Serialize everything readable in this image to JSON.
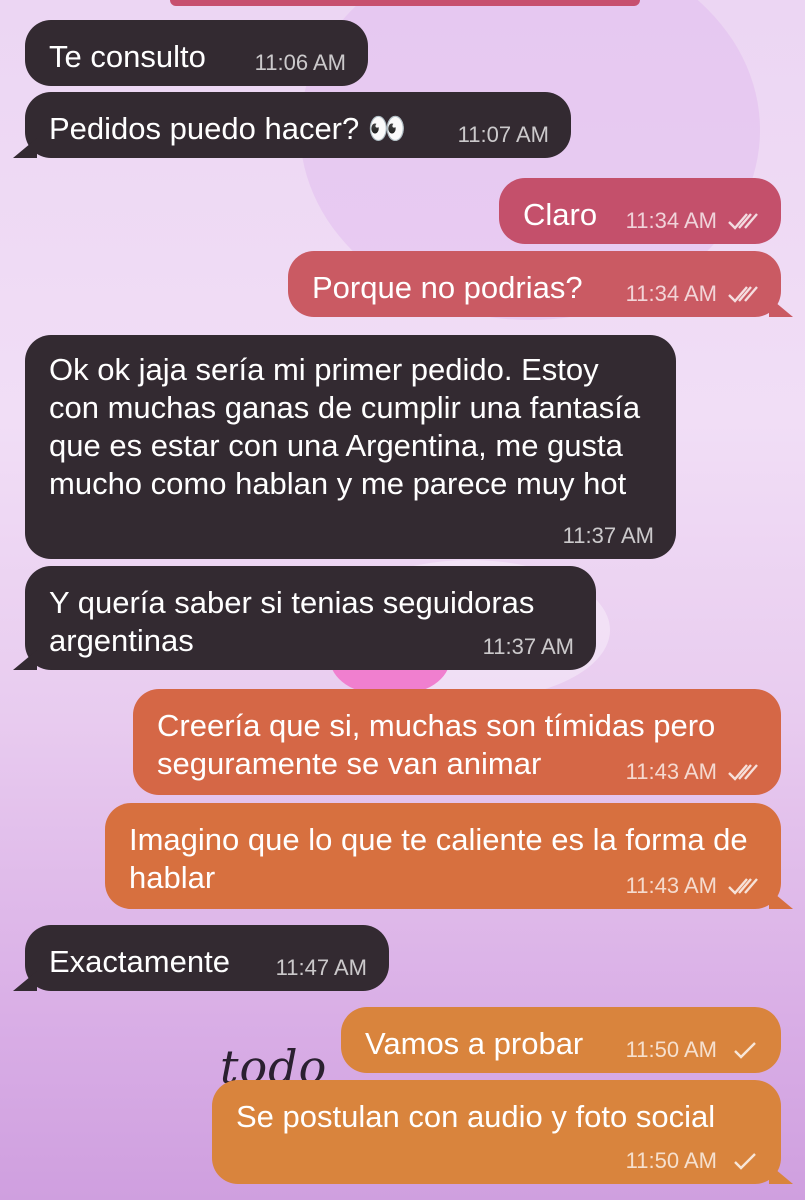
{
  "messages": [
    {
      "text": "Te consulto",
      "time": "11:06 AM",
      "dir": "in"
    },
    {
      "text": "Pedidos puedo hacer? 👀",
      "time": "11:07 AM",
      "dir": "in"
    },
    {
      "text": "Claro",
      "time": "11:34 AM",
      "dir": "out",
      "status": "double-check-icon"
    },
    {
      "text": "Porque no podrias?",
      "time": "11:34 AM",
      "dir": "out",
      "status": "double-check-icon"
    },
    {
      "text": "Ok ok jaja sería mi primer pedido. Estoy con muchas ganas de cumplir una fantasía que es estar con una Argentina, me gusta mucho como hablan y me parece muy hot",
      "time": "11:37 AM",
      "dir": "in"
    },
    {
      "text": "Y quería saber si tenias seguidoras argentinas",
      "time": "11:37 AM",
      "dir": "in"
    },
    {
      "text": "Creería que si, muchas son tímidas pero seguramente se van animar",
      "time": "11:43 AM",
      "dir": "out",
      "status": "double-check-icon"
    },
    {
      "text": "Imagino que lo que te caliente es la forma de hablar",
      "time": "11:43 AM",
      "dir": "out",
      "status": "double-check-icon"
    },
    {
      "text": "Exactamente",
      "time": "11:47 AM",
      "dir": "in"
    },
    {
      "text": "Vamos a probar",
      "time": "11:50 AM",
      "dir": "out",
      "status": "single-check-icon"
    },
    {
      "text": "Se postulan con audio y foto social",
      "time": "11:50 AM",
      "dir": "out",
      "status": "single-check-icon"
    }
  ],
  "colors": {
    "incoming": "#332a31",
    "outgoing_gradient": [
      "#c4506b",
      "#d46a48",
      "#d9843d"
    ]
  }
}
